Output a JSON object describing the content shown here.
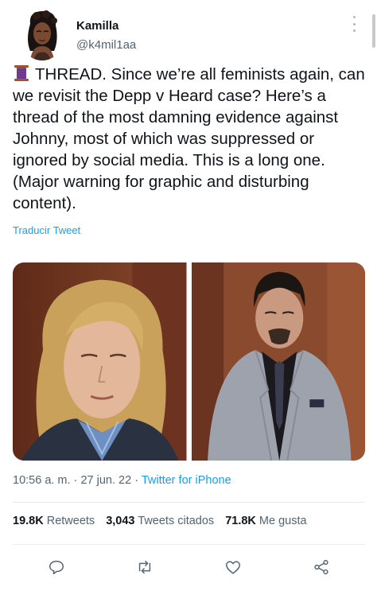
{
  "author": {
    "display_name": "Kamilla",
    "handle": "@k4mil1aa",
    "avatar_icon": "avatar-illustration"
  },
  "tweet": {
    "emoji_icon": "thread-spool-icon",
    "text": "THREAD. Since we’re all feminists again, can we revisit the Depp v Heard case? Here’s a thread of the most damning evidence against Johnny, most of which was suppressed or ignored by social media. This is a long one. (Major warning for graphic and disturbing content).",
    "translate_label": "Traducir Tweet"
  },
  "media": {
    "count": 2,
    "photo_icons": [
      "photo-woman-blonde-hair",
      "photo-man-grey-suit"
    ]
  },
  "meta": {
    "time": "10:56 a. m.",
    "separator": "·",
    "date": "27 jun. 22",
    "app": "Twitter for iPhone"
  },
  "stats": {
    "retweets_count": "19.8K",
    "retweets_label": "Retweets",
    "quotes_count": "3,043",
    "quotes_label": "Tweets citados",
    "likes_count": "71.8K",
    "likes_label": "Me gusta"
  },
  "actions": [
    "reply-icon",
    "retweet-icon",
    "like-icon",
    "share-icon"
  ],
  "colors": {
    "link": "#1d9bf0",
    "text": "#0f1419",
    "secondary": "#536471",
    "divider": "#e6ecf0"
  }
}
